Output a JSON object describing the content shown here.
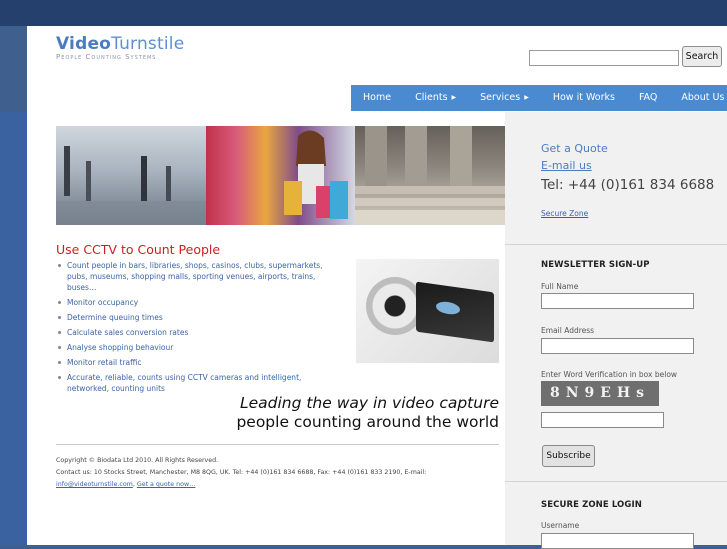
{
  "header": {
    "logo_bold": "Video",
    "logo_light": "Turnstile",
    "tagline": "People Counting Systems",
    "search_button": "Search",
    "search_value": ""
  },
  "nav": {
    "items": [
      {
        "label": "Home",
        "has_submenu": false
      },
      {
        "label": "Clients",
        "has_submenu": true
      },
      {
        "label": "Services",
        "has_submenu": true
      },
      {
        "label": "How it Works",
        "has_submenu": false
      },
      {
        "label": "FAQ",
        "has_submenu": false
      },
      {
        "label": "About Us",
        "has_submenu": false
      }
    ],
    "submenu_glyph": "▶"
  },
  "main": {
    "heading": "Use CCTV to Count People",
    "bullets": [
      "Count people in bars, libraries, shops, casinos, clubs, supermarkets, pubs, museums, shopping malls, sporting venues, airports, trains, buses…",
      "Monitor occupancy",
      "Determine queuing times",
      "Calculate sales conversion rates",
      "Analyse shopping behaviour",
      "Monitor retail traffic",
      "Accurate, reliable, counts using CCTV cameras and intelligent, networked, counting units"
    ],
    "slogan_line1": "Leading the way in video capture",
    "slogan_line2": "people counting around the world"
  },
  "footer": {
    "copyright": "Copyright © Biodata Ltd 2010. All Rights Reserved.",
    "contact": "Contact us: 10 Stocks Street, Manchester, M8 8QG, UK. Tel: +44 (0)161 834 6688, Fax: +44 (0)161 833 2190, E-mail:",
    "email_link": "info@videoturnstile.com",
    "quote_link": "Get a quote now…"
  },
  "sidebar": {
    "quote_link": "Get a Quote",
    "email_link": "E-mail us",
    "tel": "Tel: +44 (0)161 834 6688",
    "secure_zone_link": "Secure Zone",
    "newsletter": {
      "heading": "NEWSLETTER SIGN-UP",
      "full_name_label": "Full Name",
      "email_label": "Email Address",
      "verification_label": "Enter Word Verification in box below",
      "captcha_text": "8N9EHs",
      "subscribe_button": "Subscribe"
    },
    "secure_login": {
      "heading": "SECURE ZONE LOGIN",
      "username_label": "Username"
    }
  },
  "colors": {
    "nav_bg": "#4a8ad0",
    "heading_red": "#cc2020",
    "link_blue": "#3c63a8",
    "page_bg": "#3f5f8e"
  }
}
